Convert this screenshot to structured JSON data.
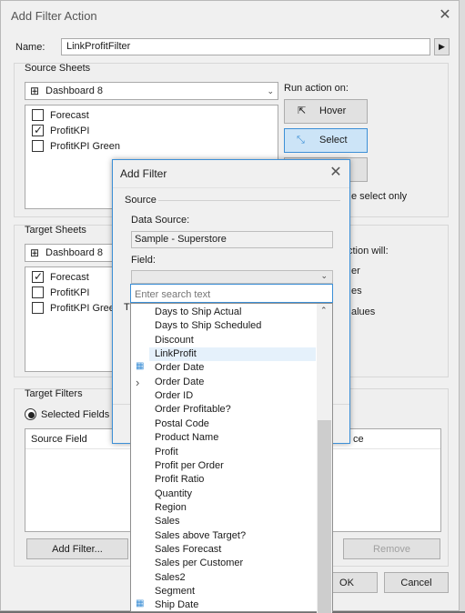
{
  "main": {
    "title": "Add Filter Action",
    "name_label": "Name:",
    "name_value": "LinkProfitFilter",
    "source_sheets": {
      "heading": "Source Sheets",
      "dashboard": "Dashboard 8",
      "sheets": [
        {
          "label": "Forecast",
          "checked": false
        },
        {
          "label": "ProfitKPI",
          "checked": true
        },
        {
          "label": "ProfitKPI Green",
          "checked": false
        }
      ]
    },
    "run_action": {
      "heading": "Run action on:",
      "hover": "Hover",
      "select": "Select",
      "select_only_fragment": "e select only"
    },
    "target_sheets": {
      "heading": "Target Sheets",
      "dashboard": "Dashboard 8",
      "sheets": [
        {
          "label": "Forecast",
          "checked": true
        },
        {
          "label": "ProfitKPI",
          "checked": false
        },
        {
          "label": "ProfitKPI Green",
          "checked": false
        }
      ],
      "action_fragments": [
        "ction will:",
        "er",
        "es",
        "alues"
      ]
    },
    "target_filters": {
      "heading": "Target Filters",
      "selected_fields": "Selected Fields",
      "source_field_col": "Source Field",
      "target_field_col_fragment": "ce"
    },
    "buttons": {
      "add_filter": "Add Filter...",
      "remove": "Remove",
      "ok": "OK",
      "cancel": "Cancel"
    }
  },
  "add_filter": {
    "title": "Add Filter",
    "source_heading": "Source",
    "data_source_label": "Data Source:",
    "data_source_value": "Sample - Superstore",
    "field_label": "Field:",
    "search_placeholder": "Enter search text",
    "fragment_t": "T"
  },
  "field_list": [
    {
      "label": "Days to Ship Actual",
      "icon": ""
    },
    {
      "label": "Days to Ship Scheduled",
      "icon": ""
    },
    {
      "label": "Discount",
      "icon": ""
    },
    {
      "label": "LinkProfit",
      "icon": "",
      "highlighted": true
    },
    {
      "label": "Order Date",
      "icon": "calendar-icon"
    },
    {
      "label": "Order Date",
      "icon": "chevron-right-icon"
    },
    {
      "label": "Order ID",
      "icon": ""
    },
    {
      "label": "Order Profitable?",
      "icon": ""
    },
    {
      "label": "Postal Code",
      "icon": ""
    },
    {
      "label": "Product Name",
      "icon": ""
    },
    {
      "label": "Profit",
      "icon": ""
    },
    {
      "label": "Profit per Order",
      "icon": ""
    },
    {
      "label": "Profit Ratio",
      "icon": ""
    },
    {
      "label": "Quantity",
      "icon": ""
    },
    {
      "label": "Region",
      "icon": ""
    },
    {
      "label": "Sales",
      "icon": ""
    },
    {
      "label": "Sales above Target?",
      "icon": ""
    },
    {
      "label": "Sales Forecast",
      "icon": ""
    },
    {
      "label": "Sales per Customer",
      "icon": ""
    },
    {
      "label": "Sales2",
      "icon": ""
    },
    {
      "label": "Segment",
      "icon": ""
    },
    {
      "label": "Ship Date",
      "icon": "calendar-icon"
    }
  ],
  "colors": {
    "accent": "#3c8fd6",
    "selected_button": "#cce4f7",
    "highlight_row": "#e5f1fb",
    "background_red": "#c8202a",
    "background_green": "#2f9a43"
  }
}
